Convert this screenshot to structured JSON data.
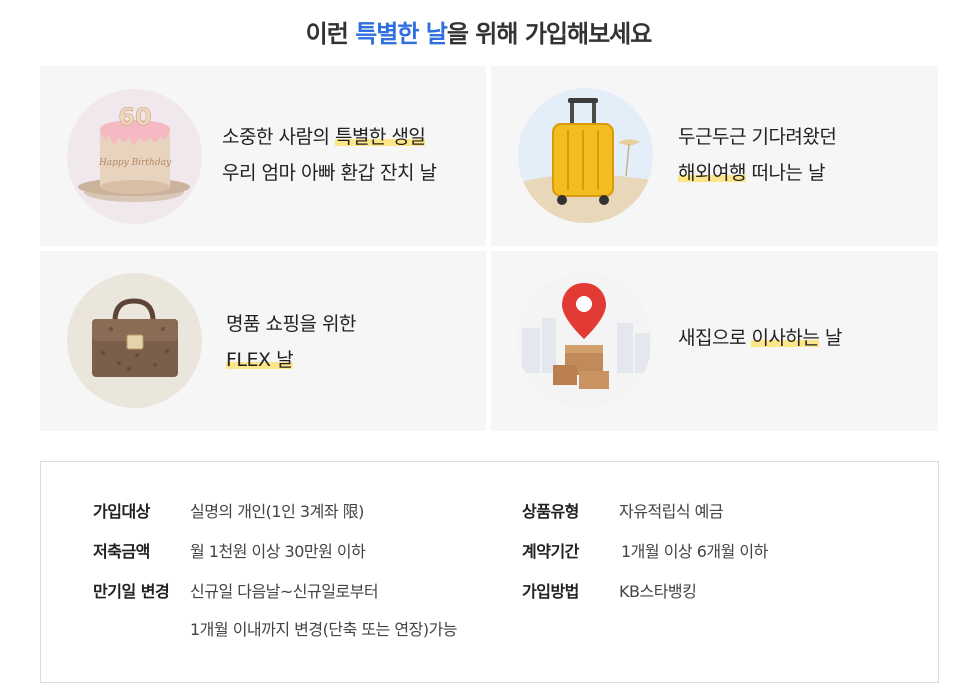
{
  "heading": {
    "before": "이런 ",
    "highlight": "특별한 날",
    "after": "을 위해 가입해보세요"
  },
  "cards": [
    {
      "image": "60th-birthday-cake",
      "cake_number": "60",
      "cake_text": "Happy Birthday",
      "line1_pre": "소중한 사람의 ",
      "line1_mark": "특별한 생일",
      "line2": "우리 엄마 아빠 환갑 잔치 날"
    },
    {
      "image": "yellow-suitcase",
      "line1": "두근두근 기다려왔던",
      "line2_mark": "해외여행",
      "line2_post": " 떠나는 날"
    },
    {
      "image": "luxury-handbag",
      "line1": "명품 쇼핑을 위한",
      "line2_mark": "FLEX 날"
    },
    {
      "image": "location-pin-moving-boxes",
      "line_pre": "새집으로 ",
      "line_mark": "이사하는",
      "line_post": " 날"
    }
  ],
  "info": {
    "left": [
      {
        "label": "가입대상",
        "value": "실명의 개인(1인 3계좌 限)"
      },
      {
        "label": "저축금액",
        "value": "월 1천원 이상 30만원 이하"
      },
      {
        "label": "만기일 변경",
        "value": "신규일 다음날~신규일로부터",
        "value2": "1개월 이내까지 변경(단축 또는 연장)가능"
      }
    ],
    "right": [
      {
        "label": "상품유형",
        "value": "자유적립식 예금"
      },
      {
        "label": "계약기간",
        "value": "1개월 이상 6개월 이하"
      },
      {
        "label": "가입방법",
        "value": "KB스타뱅킹"
      }
    ]
  },
  "colors": {
    "accent": "#2f6fde",
    "highlight": "#fde58a",
    "card_bg": "#f6f6f6"
  }
}
